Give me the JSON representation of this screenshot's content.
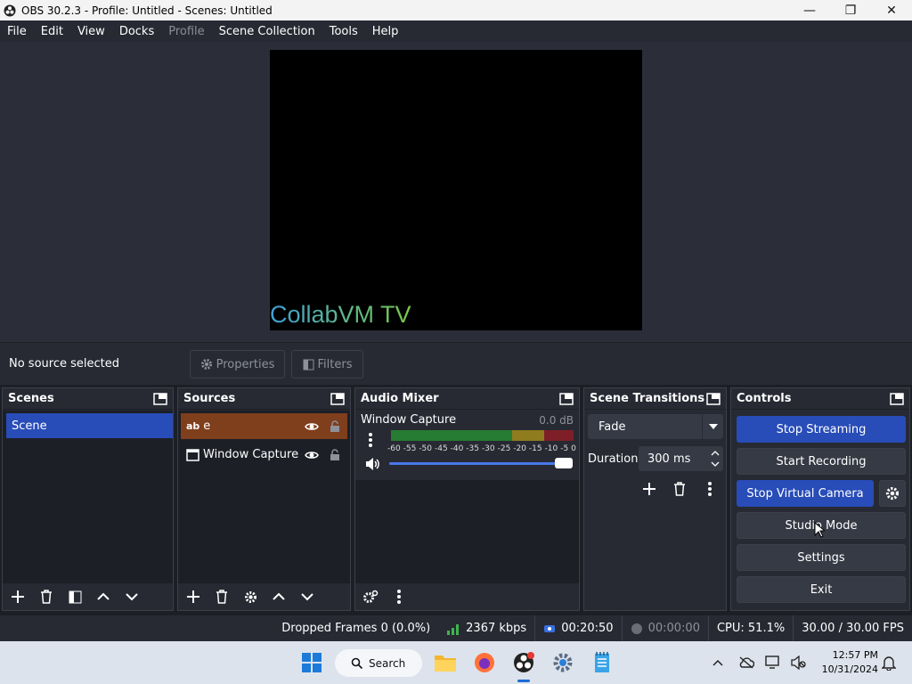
{
  "window": {
    "title": "OBS 30.2.3 - Profile: Untitled - Scenes: Untitled",
    "minimize": "—",
    "maximize": "❐",
    "close": "✕"
  },
  "menu": [
    "File",
    "Edit",
    "View",
    "Docks",
    "Profile",
    "Scene Collection",
    "Tools",
    "Help"
  ],
  "menu_disabled": [
    "Profile"
  ],
  "preview": {
    "overlay_text": "CollabVM TV"
  },
  "context_bar": {
    "status": "No source selected",
    "properties_label": "Properties",
    "filters_label": "Filters"
  },
  "scenes": {
    "title": "Scenes",
    "items": [
      "Scene"
    ]
  },
  "sources": {
    "title": "Sources",
    "items": [
      {
        "type_label": "ab",
        "name": "e"
      },
      {
        "name": "Window Capture"
      }
    ]
  },
  "audio_mixer": {
    "title": "Audio Mixer",
    "channel_name": "Window Capture",
    "db": "0.0 dB",
    "ticks": [
      "-60",
      "-55",
      "-50",
      "-45",
      "-40",
      "-35",
      "-30",
      "-25",
      "-20",
      "-15",
      "-10",
      "-5",
      "0"
    ],
    "volume_level": 1.0
  },
  "transitions": {
    "title": "Scene Transitions",
    "selected": "Fade",
    "duration_label": "Duration",
    "duration_value": "300 ms"
  },
  "controls": {
    "title": "Controls",
    "stop_streaming": "Stop Streaming",
    "start_recording": "Start Recording",
    "stop_virtual_camera": "Stop Virtual Camera",
    "studio_mode": "Studio Mode",
    "settings": "Settings",
    "exit": "Exit"
  },
  "status": {
    "dropped_frames": "Dropped Frames 0 (0.0%)",
    "bitrate": "2367 kbps",
    "stream_time": "00:20:50",
    "record_time": "00:00:00",
    "cpu": "CPU: 51.1%",
    "fps": "30.00 / 30.00 FPS"
  },
  "taskbar": {
    "search_label": "Search",
    "time": "12:57 PM",
    "date": "10/31/2024"
  },
  "colors": {
    "accent": "#284cb8",
    "selected_source": "#7f3e1c",
    "panel": "#272a33",
    "background": "#1d1f26"
  }
}
